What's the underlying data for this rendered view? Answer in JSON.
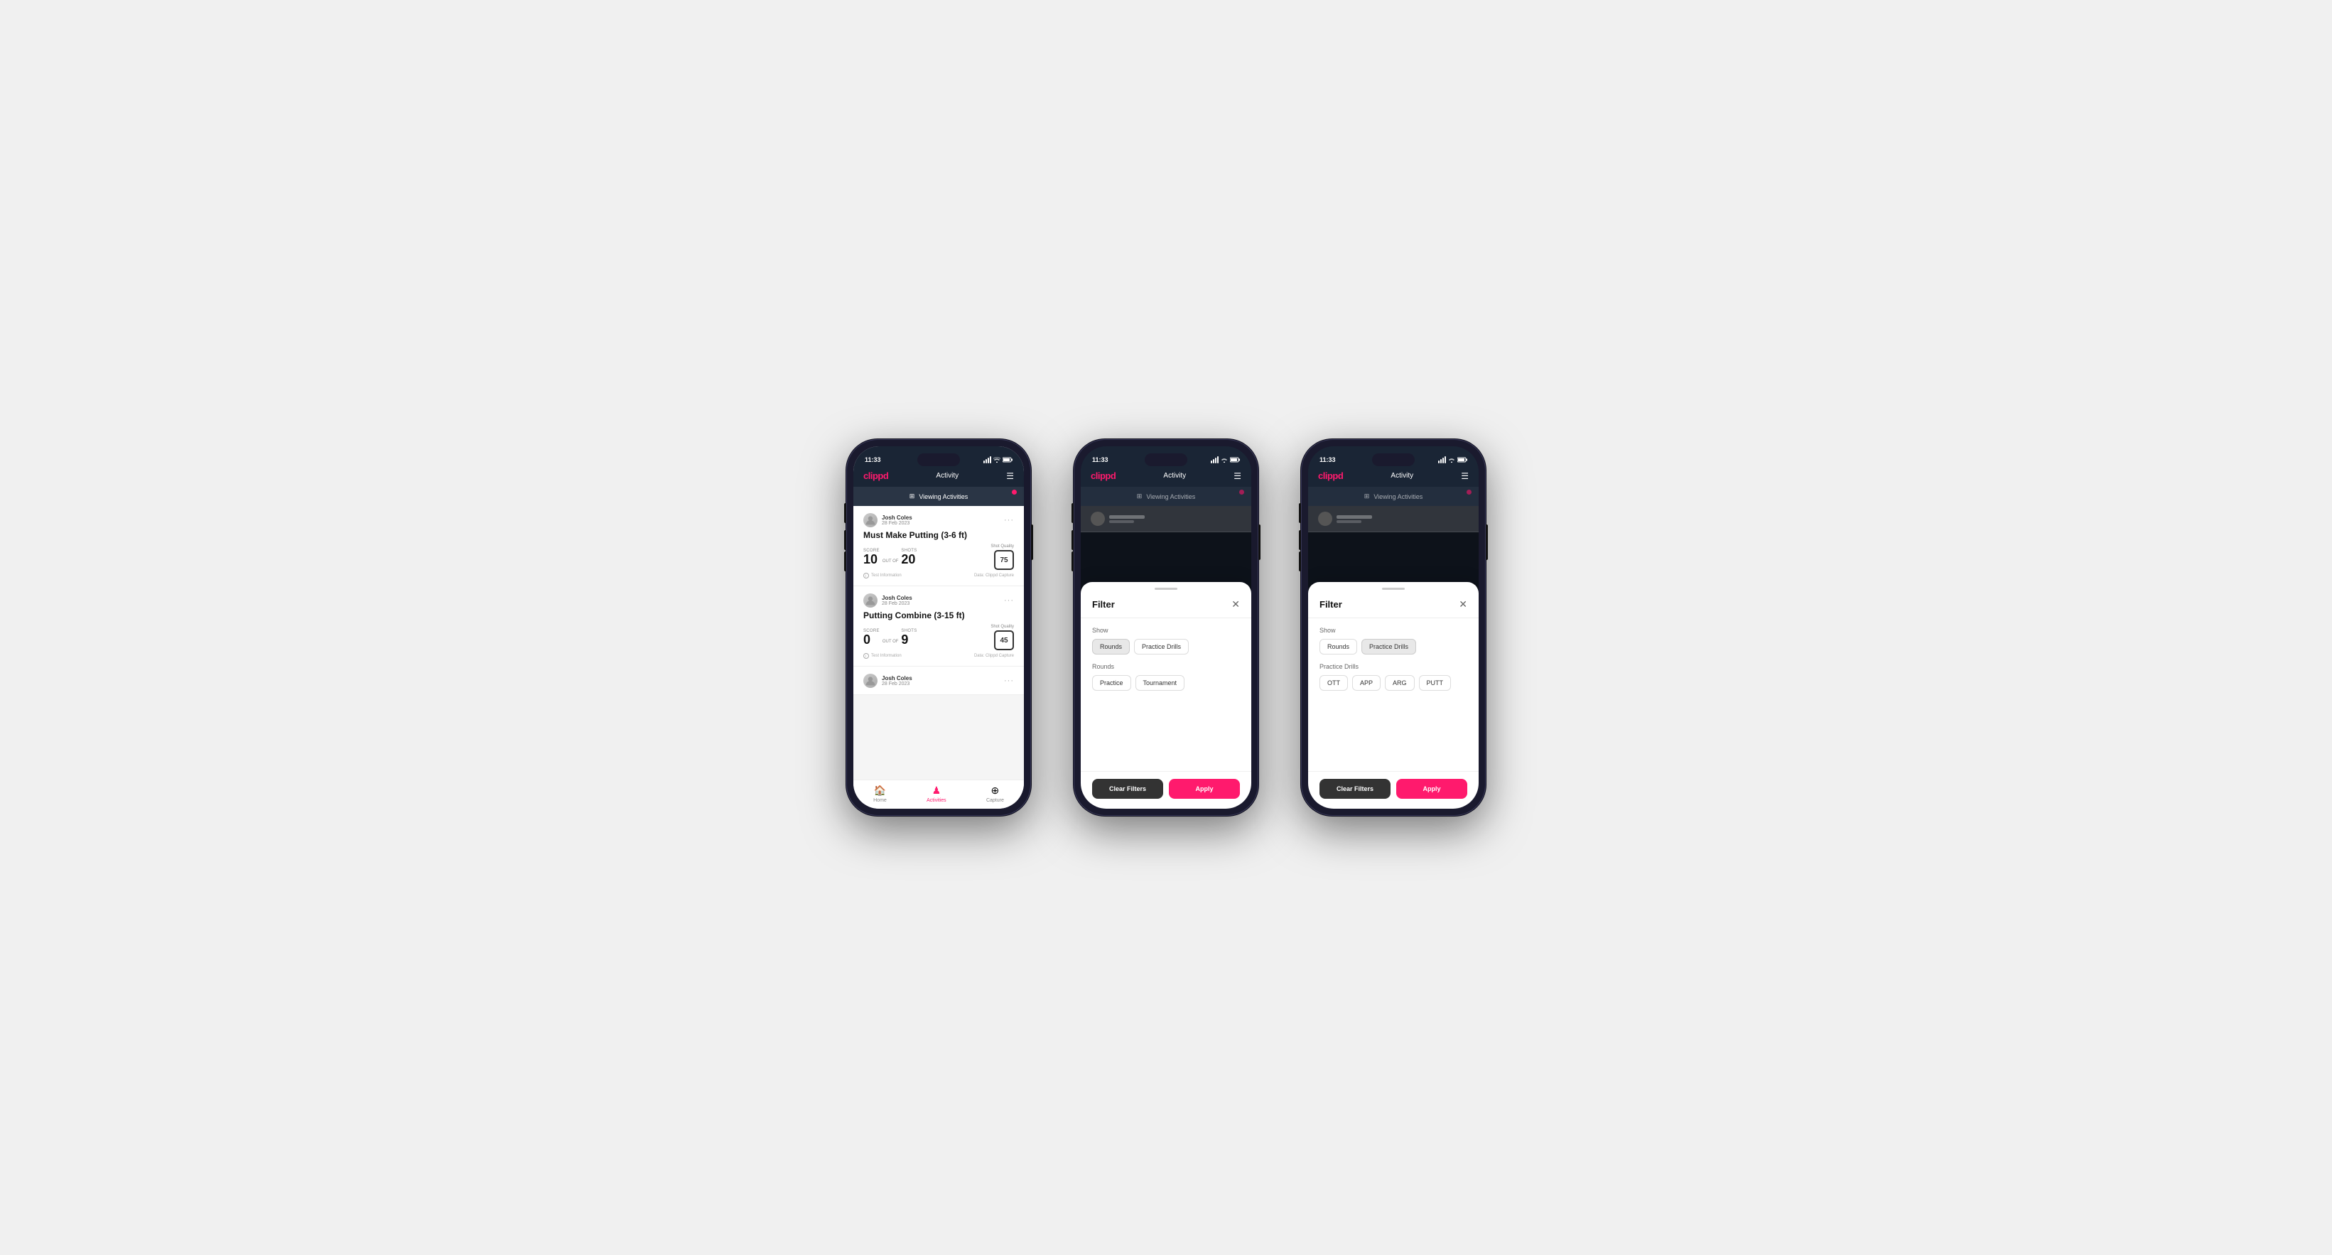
{
  "phones": [
    {
      "id": "phone1",
      "type": "activity-list",
      "status": {
        "time": "11:33",
        "signal_label": "signal",
        "wifi_label": "wifi",
        "battery_label": "battery"
      },
      "header": {
        "logo": "clippd",
        "title": "Activity",
        "menu_label": "menu"
      },
      "viewing_bar": {
        "label": "Viewing Activities",
        "icon": "filter-icon"
      },
      "cards": [
        {
          "user_name": "Josh Coles",
          "user_date": "28 Feb 2023",
          "title": "Must Make Putting (3-6 ft)",
          "score_label": "Score",
          "score_value": "10",
          "out_of_label": "OUT OF",
          "shots_label": "Shots",
          "shots_value": "20",
          "shot_quality_label": "Shot Quality",
          "shot_quality_value": "75",
          "test_info": "Test Information",
          "data_source": "Data: Clippd Capture"
        },
        {
          "user_name": "Josh Coles",
          "user_date": "28 Feb 2023",
          "title": "Putting Combine (3-15 ft)",
          "score_label": "Score",
          "score_value": "0",
          "out_of_label": "OUT OF",
          "shots_label": "Shots",
          "shots_value": "9",
          "shot_quality_label": "Shot Quality",
          "shot_quality_value": "45",
          "test_info": "Test Information",
          "data_source": "Data: Clippd Capture"
        },
        {
          "user_name": "Josh Coles",
          "user_date": "28 Feb 2023",
          "title": "",
          "score_label": "",
          "score_value": "",
          "out_of_label": "",
          "shots_label": "",
          "shots_value": "",
          "shot_quality_label": "",
          "shot_quality_value": "",
          "test_info": "",
          "data_source": ""
        }
      ],
      "bottom_nav": {
        "home_label": "Home",
        "activities_label": "Activities",
        "capture_label": "Capture"
      }
    },
    {
      "id": "phone2",
      "type": "filter-rounds",
      "status": {
        "time": "11:33"
      },
      "header": {
        "logo": "clippd",
        "title": "Activity",
        "menu_label": "menu"
      },
      "viewing_bar": {
        "label": "Viewing Activities"
      },
      "filter": {
        "title": "Filter",
        "show_label": "Show",
        "show_options": [
          {
            "label": "Rounds",
            "active": true
          },
          {
            "label": "Practice Drills",
            "active": false
          }
        ],
        "rounds_label": "Rounds",
        "rounds_options": [
          {
            "label": "Practice",
            "active": false
          },
          {
            "label": "Tournament",
            "active": false
          }
        ],
        "clear_label": "Clear Filters",
        "apply_label": "Apply"
      }
    },
    {
      "id": "phone3",
      "type": "filter-practice",
      "status": {
        "time": "11:33"
      },
      "header": {
        "logo": "clippd",
        "title": "Activity",
        "menu_label": "menu"
      },
      "viewing_bar": {
        "label": "Viewing Activities"
      },
      "filter": {
        "title": "Filter",
        "show_label": "Show",
        "show_options": [
          {
            "label": "Rounds",
            "active": false
          },
          {
            "label": "Practice Drills",
            "active": true
          }
        ],
        "practice_drills_label": "Practice Drills",
        "practice_options": [
          {
            "label": "OTT",
            "active": false
          },
          {
            "label": "APP",
            "active": false
          },
          {
            "label": "ARG",
            "active": false
          },
          {
            "label": "PUTT",
            "active": false
          }
        ],
        "clear_label": "Clear Filters",
        "apply_label": "Apply"
      }
    }
  ]
}
